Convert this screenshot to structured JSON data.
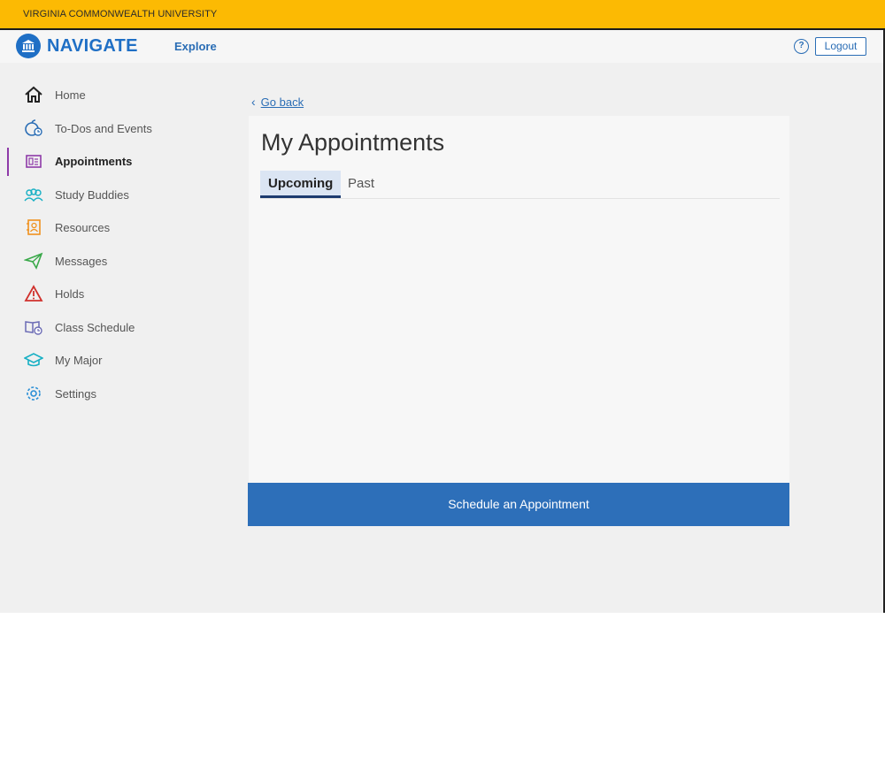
{
  "university_bar": {
    "text": "VIRGINIA COMMONWEALTH UNIVERSITY",
    "color": "#fcba03"
  },
  "header": {
    "logo_text": "NAVIGATE",
    "logo_icon": "institution-icon",
    "explore_label": "Explore",
    "help_label": "?",
    "logout_label": "Logout",
    "brand_color": "#1f6fc5"
  },
  "sidebar": {
    "items": [
      {
        "label": "Home",
        "icon": "home-icon",
        "active": false
      },
      {
        "label": "To-Dos and Events",
        "icon": "apple-clock-icon",
        "active": false
      },
      {
        "label": "Appointments",
        "icon": "appointment-card-icon",
        "active": true
      },
      {
        "label": "Study Buddies",
        "icon": "people-icon",
        "active": false
      },
      {
        "label": "Resources",
        "icon": "contact-book-icon",
        "active": false
      },
      {
        "label": "Messages",
        "icon": "paper-plane-icon",
        "active": false
      },
      {
        "label": "Holds",
        "icon": "warning-triangle-icon",
        "active": false
      },
      {
        "label": "Class Schedule",
        "icon": "book-schedule-icon",
        "active": false
      },
      {
        "label": "My Major",
        "icon": "graduation-cap-icon",
        "active": false
      },
      {
        "label": "Settings",
        "icon": "gear-icon",
        "active": false
      }
    ]
  },
  "main": {
    "go_back_label": "Go back",
    "title": "My Appointments",
    "tabs": [
      {
        "label": "Upcoming",
        "active": true
      },
      {
        "label": "Past",
        "active": false
      }
    ],
    "schedule_button_label": "Schedule an Appointment",
    "accent_color": "#2d6fb9"
  }
}
